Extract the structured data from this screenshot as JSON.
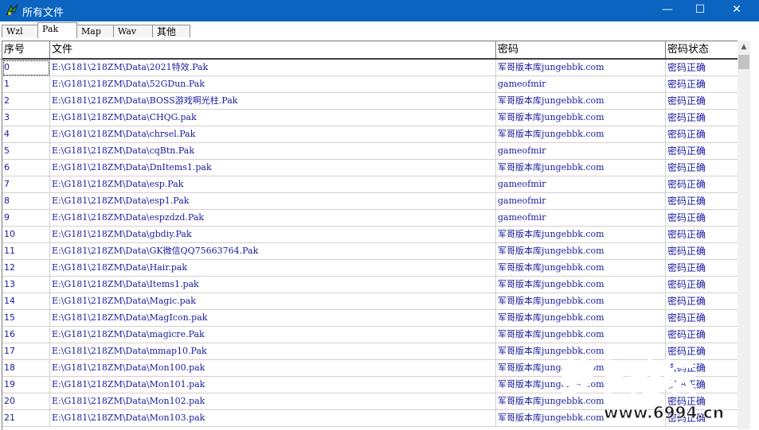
{
  "window": {
    "title": "所有文件",
    "minimize": "—",
    "maximize": "☐",
    "close": "✕"
  },
  "tabs": [
    {
      "label": "Wzl",
      "active": false
    },
    {
      "label": "Pak",
      "active": true
    },
    {
      "label": "Map",
      "active": false
    },
    {
      "label": "Wav",
      "active": false
    },
    {
      "label": "其他",
      "active": false
    }
  ],
  "table": {
    "columns": [
      "序号",
      "文件",
      "密码",
      "密码状态"
    ],
    "rows": [
      [
        "0",
        "E:\\G181\\218ZM\\Data\\2021特效.Pak",
        "军哥版本库jungebbk.com",
        "密码正确"
      ],
      [
        "1",
        "E:\\G181\\218ZM\\Data\\52GDun.Pak",
        "gameofmir",
        "密码正确"
      ],
      [
        "2",
        "E:\\G181\\218ZM\\Data\\BOSS游戏啊光柱.Pak",
        "军哥版本库jungebbk.com",
        "密码正确"
      ],
      [
        "3",
        "E:\\G181\\218ZM\\Data\\CHQG.pak",
        "军哥版本库jungebbk.com",
        "密码正确"
      ],
      [
        "4",
        "E:\\G181\\218ZM\\Data\\chrsel.Pak",
        "军哥版本库jungebbk.com",
        "密码正确"
      ],
      [
        "5",
        "E:\\G181\\218ZM\\Data\\cqBtn.Pak",
        "gameofmir",
        "密码正确"
      ],
      [
        "6",
        "E:\\G181\\218ZM\\Data\\DnItems1.pak",
        "军哥版本库jungebbk.com",
        "密码正确"
      ],
      [
        "7",
        "E:\\G181\\218ZM\\Data\\esp.Pak",
        "gameofmir",
        "密码正确"
      ],
      [
        "8",
        "E:\\G181\\218ZM\\Data\\esp1.Pak",
        "gameofmir",
        "密码正确"
      ],
      [
        "9",
        "E:\\G181\\218ZM\\Data\\espzdzd.Pak",
        "gameofmir",
        "密码正确"
      ],
      [
        "10",
        "E:\\G181\\218ZM\\Data\\gbdiy.Pak",
        "军哥版本库jungebbk.com",
        "密码正确"
      ],
      [
        "11",
        "E:\\G181\\218ZM\\Data\\GK微信QQ75663764.Pak",
        "军哥版本库jungebbk.com",
        "密码正确"
      ],
      [
        "12",
        "E:\\G181\\218ZM\\Data\\Hair.pak",
        "军哥版本库jungebbk.com",
        "密码正确"
      ],
      [
        "13",
        "E:\\G181\\218ZM\\Data\\Items1.pak",
        "军哥版本库jungebbk.com",
        "密码正确"
      ],
      [
        "14",
        "E:\\G181\\218ZM\\Data\\Magic.pak",
        "军哥版本库jungebbk.com",
        "密码正确"
      ],
      [
        "15",
        "E:\\G181\\218ZM\\Data\\MagIcon.pak",
        "军哥版本库jungebbk.com",
        "密码正确"
      ],
      [
        "16",
        "E:\\G181\\218ZM\\Data\\magicre.Pak",
        "军哥版本库jungebbk.com",
        "密码正确"
      ],
      [
        "17",
        "E:\\G181\\218ZM\\Data\\mmap10.Pak",
        "军哥版本库jungebbk.com",
        "密码正确"
      ],
      [
        "18",
        "E:\\G181\\218ZM\\Data\\Mon100.pak",
        "军哥版本库jungebbk.com",
        "密码正确"
      ],
      [
        "19",
        "E:\\G181\\218ZM\\Data\\Mon101.pak",
        "军哥版本库jungebbk.com",
        "密码正确"
      ],
      [
        "20",
        "E:\\G181\\218ZM\\Data\\Mon102.pak",
        "军哥版本库jungebbk.com",
        "密码正确"
      ],
      [
        "21",
        "E:\\G181\\218ZM\\Data\\Mon103.pak",
        "军哥版本库jungebbk.com",
        "密码正确"
      ]
    ]
  },
  "watermark": {
    "brand": "萝卜论坛",
    "url": "www.6994.cn"
  },
  "colors": {
    "titlebar": "#0a64c0",
    "cell_text": "#1a1a9c",
    "watermark_red": "#e0311e"
  }
}
